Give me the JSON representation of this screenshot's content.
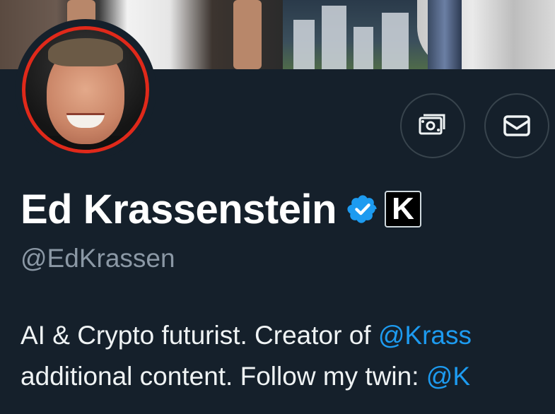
{
  "profile": {
    "display_name": "Ed Krassenstein",
    "handle": "@EdKrassen",
    "affiliation_badge": "K",
    "verified_color": "#1d9bf0",
    "avatar_ring_color": "#e0291a"
  },
  "bio": {
    "line1_text": "AI & Crypto futurist. Creator of ",
    "line1_mention": "@Krass",
    "line2_text": "additional content. Follow my twin: ",
    "line2_mention": "@K"
  },
  "actions": {
    "tip_icon": "money-icon",
    "message_icon": "mail-icon"
  },
  "theme": {
    "background": "#15202b",
    "text_primary": "#ffffff",
    "text_secondary": "#8b98a5",
    "link": "#1d9bf0",
    "border": "#38444d"
  }
}
